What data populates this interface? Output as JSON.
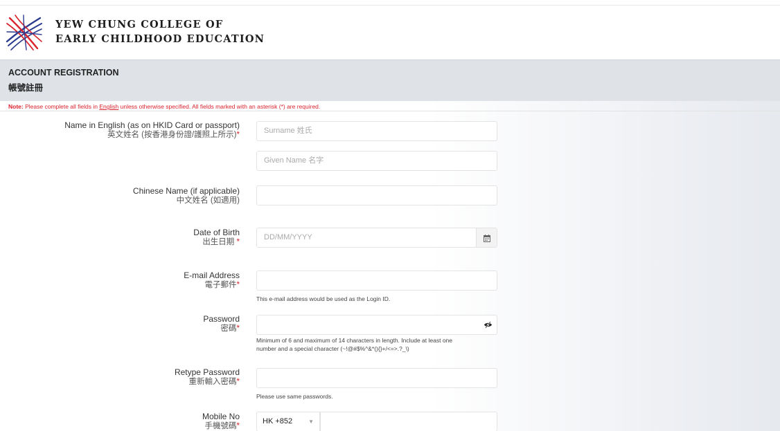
{
  "header": {
    "college_line1": "YEW CHUNG COLLEGE OF",
    "college_line2": "EARLY CHILDHOOD EDUCATION"
  },
  "page": {
    "title_en": "ACCOUNT REGISTRATION",
    "title_zh": "帳號註冊"
  },
  "note": {
    "prefix": "Note:",
    "text_before": " Please complete all fields in ",
    "link": "English",
    "text_after": " unless otherwise specified. All fields marked with an asterisk (*) are required."
  },
  "form": {
    "name_en": {
      "label_en": "Name in English (as on HKID Card or passport)",
      "label_zh": "英文姓名 (按香港身份證/護照上所示)",
      "surname_placeholder": "Surname 姓氏",
      "given_placeholder": "Given Name 名字"
    },
    "name_zh": {
      "label_en": "Chinese Name (if applicable)",
      "label_zh": "中文姓名 (如適用)"
    },
    "dob": {
      "label_en": "Date of Birth",
      "label_zh": "出生日期",
      "placeholder": "DD/MM/YYYY"
    },
    "email": {
      "label_en": "E-mail Address",
      "label_zh": "電子郵件",
      "help": "This e-mail address would be used as the Login ID."
    },
    "password": {
      "label_en": "Password",
      "label_zh": "密碼",
      "help_line1": "Minimum of 6 and maximum of 14 characters in length. Include at least one",
      "help_line2": "number and a special character (~!@#$%^&*(){}+/<=>.?_\\)"
    },
    "retype_password": {
      "label_en": "Retype Password",
      "label_zh": "重新輸入密碼",
      "help": "Please use same passwords."
    },
    "mobile": {
      "label_en": "Mobile No",
      "label_zh": "手機號碼",
      "country_code": "HK +852"
    },
    "required_mark": "*"
  },
  "icons": {
    "calendar": "calendar-icon",
    "eye": "eye-slash-icon",
    "caret": "chevron-down-icon"
  },
  "colors": {
    "required": "#d9232d",
    "band": "#dfe3e8",
    "logo_red": "#d9232d",
    "logo_blue": "#2a3b8f"
  }
}
